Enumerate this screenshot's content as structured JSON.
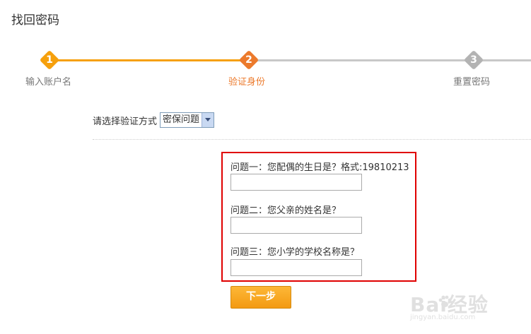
{
  "page": {
    "title": "找回密码"
  },
  "steps": [
    {
      "number": "1",
      "label": "输入账户名",
      "state": "done",
      "color": "#f6a00c"
    },
    {
      "number": "2",
      "label": "验证身份",
      "state": "current",
      "color": "#ec7a2c"
    },
    {
      "number": "3",
      "label": "重置密码",
      "state": "pending",
      "color": "#b3b3b3"
    }
  ],
  "method": {
    "label": "请选择验证方式",
    "selected": "密保问题"
  },
  "questions": [
    {
      "label": "问题一：您配偶的生日是？格式:19810213",
      "value": ""
    },
    {
      "label": "问题二：您父亲的姓名是？",
      "value": ""
    },
    {
      "label": "问题三：您小学的学校名称是？",
      "value": ""
    }
  ],
  "actions": {
    "next_label": "下一步"
  },
  "watermark": {
    "mark": "Bai经验",
    "sub": "jingyan.baidu.com"
  },
  "colors": {
    "accent": "#f6a00c",
    "highlight": "#e00000"
  }
}
